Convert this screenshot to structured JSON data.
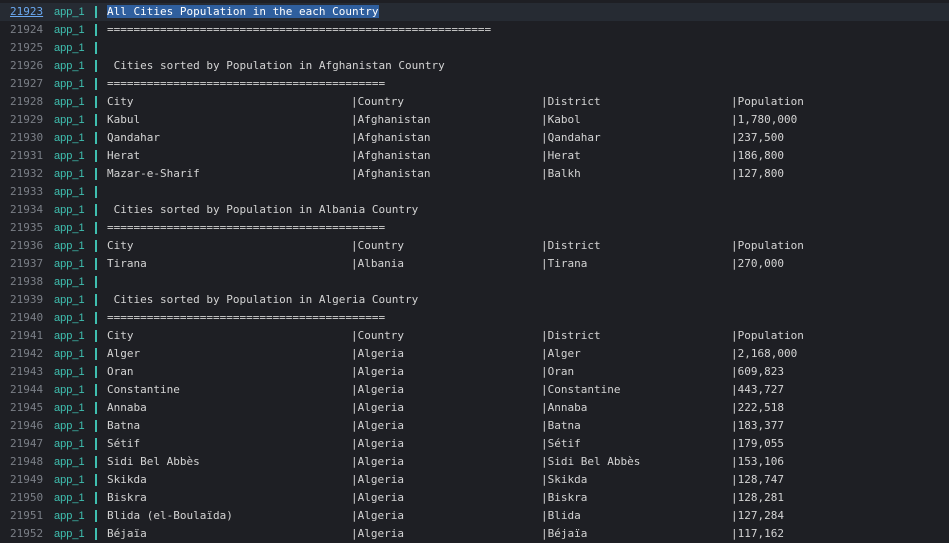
{
  "service": "app_1",
  "colors": {
    "background": "#1e1f24",
    "service_accent": "#3fbfb0",
    "line_number": "#7b7f87",
    "link": "#6aa8f0",
    "selection": "#2f5f9e"
  },
  "lines": [
    {
      "n": "21923",
      "type": "text",
      "text": "All Cities Population in the each Country",
      "highlight": true,
      "link": true
    },
    {
      "n": "21924",
      "type": "text",
      "text": "=========================================================="
    },
    {
      "n": "21925",
      "type": "text",
      "text": ""
    },
    {
      "n": "21926",
      "type": "text",
      "text": " Cities sorted by Population in Afghanistan Country"
    },
    {
      "n": "21927",
      "type": "text",
      "text": "=========================================="
    },
    {
      "n": "21928",
      "type": "row",
      "cells": [
        "City",
        "|Country",
        "|District",
        "|Population"
      ]
    },
    {
      "n": "21929",
      "type": "row",
      "cells": [
        "Kabul",
        "|Afghanistan",
        "|Kabol",
        "|1,780,000"
      ]
    },
    {
      "n": "21930",
      "type": "row",
      "cells": [
        "Qandahar",
        "|Afghanistan",
        "|Qandahar",
        "|237,500"
      ]
    },
    {
      "n": "21931",
      "type": "row",
      "cells": [
        "Herat",
        "|Afghanistan",
        "|Herat",
        "|186,800"
      ]
    },
    {
      "n": "21932",
      "type": "row",
      "cells": [
        "Mazar-e-Sharif",
        "|Afghanistan",
        "|Balkh",
        "|127,800"
      ]
    },
    {
      "n": "21933",
      "type": "text",
      "text": ""
    },
    {
      "n": "21934",
      "type": "text",
      "text": " Cities sorted by Population in Albania Country"
    },
    {
      "n": "21935",
      "type": "text",
      "text": "=========================================="
    },
    {
      "n": "21936",
      "type": "row",
      "cells": [
        "City",
        "|Country",
        "|District",
        "|Population"
      ]
    },
    {
      "n": "21937",
      "type": "row",
      "cells": [
        "Tirana",
        "|Albania",
        "|Tirana",
        "|270,000"
      ]
    },
    {
      "n": "21938",
      "type": "text",
      "text": ""
    },
    {
      "n": "21939",
      "type": "text",
      "text": " Cities sorted by Population in Algeria Country"
    },
    {
      "n": "21940",
      "type": "text",
      "text": "=========================================="
    },
    {
      "n": "21941",
      "type": "row",
      "cells": [
        "City",
        "|Country",
        "|District",
        "|Population"
      ]
    },
    {
      "n": "21942",
      "type": "row",
      "cells": [
        "Alger",
        "|Algeria",
        "|Alger",
        "|2,168,000"
      ]
    },
    {
      "n": "21943",
      "type": "row",
      "cells": [
        "Oran",
        "|Algeria",
        "|Oran",
        "|609,823"
      ]
    },
    {
      "n": "21944",
      "type": "row",
      "cells": [
        "Constantine",
        "|Algeria",
        "|Constantine",
        "|443,727"
      ]
    },
    {
      "n": "21945",
      "type": "row",
      "cells": [
        "Annaba",
        "|Algeria",
        "|Annaba",
        "|222,518"
      ]
    },
    {
      "n": "21946",
      "type": "row",
      "cells": [
        "Batna",
        "|Algeria",
        "|Batna",
        "|183,377"
      ]
    },
    {
      "n": "21947",
      "type": "row",
      "cells": [
        "Sétif",
        "|Algeria",
        "|Sétif",
        "|179,055"
      ]
    },
    {
      "n": "21948",
      "type": "row",
      "cells": [
        "Sidi Bel Abbès",
        "|Algeria",
        "|Sidi Bel Abbès",
        "|153,106"
      ]
    },
    {
      "n": "21949",
      "type": "row",
      "cells": [
        "Skikda",
        "|Algeria",
        "|Skikda",
        "|128,747"
      ]
    },
    {
      "n": "21950",
      "type": "row",
      "cells": [
        "Biskra",
        "|Algeria",
        "|Biskra",
        "|128,281"
      ]
    },
    {
      "n": "21951",
      "type": "row",
      "cells": [
        "Blida (el-Boulaïda)",
        "|Algeria",
        "|Blida",
        "|127,284"
      ]
    },
    {
      "n": "21952",
      "type": "row",
      "cells": [
        "Béjaïa",
        "|Algeria",
        "|Béjaïa",
        "|117,162"
      ]
    }
  ]
}
